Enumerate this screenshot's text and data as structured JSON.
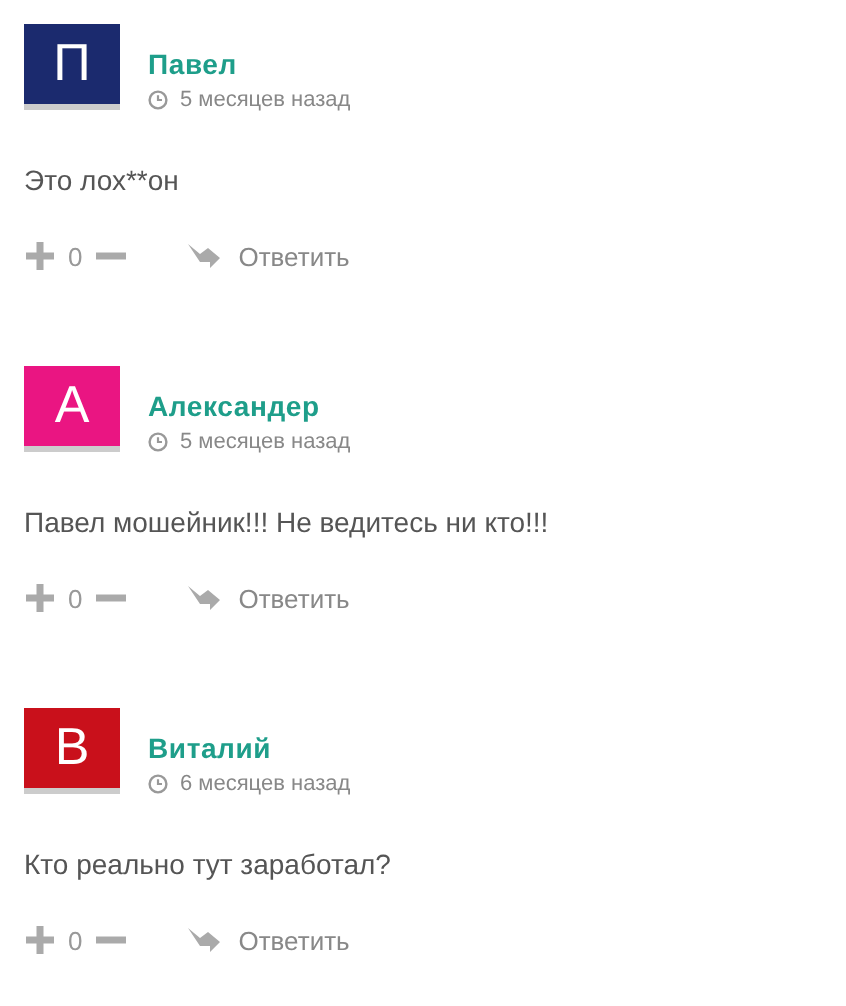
{
  "comments": [
    {
      "avatar_letter": "П",
      "color": "#1b2a6e",
      "author": "Павел",
      "time": "5 месяцев назад",
      "text": "Это лох**он",
      "score": "0",
      "reply": "Ответить"
    },
    {
      "avatar_letter": "А",
      "color": "#ea1582",
      "author": "Александер",
      "time": "5 месяцев назад",
      "text": "Павел мошейник!!! Не ведитесь ни кто!!!",
      "score": "0",
      "reply": "Ответить"
    },
    {
      "avatar_letter": "В",
      "color": "#c9101b",
      "author": "Виталий",
      "time": "6 месяцев назад",
      "text": "Кто реально тут заработал?",
      "score": "0",
      "reply": "Ответить"
    }
  ]
}
